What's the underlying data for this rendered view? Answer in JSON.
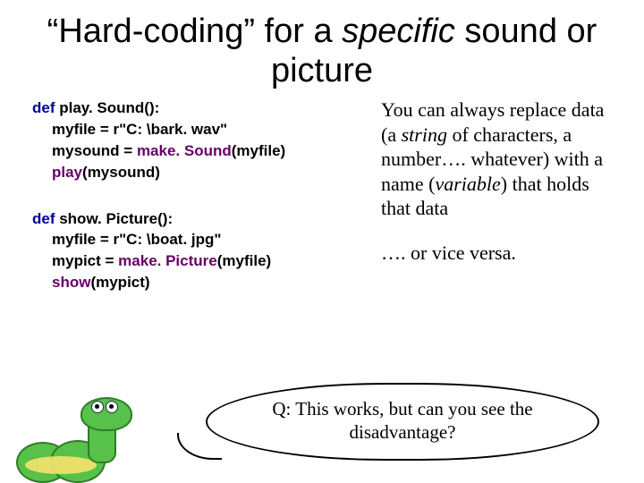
{
  "title": {
    "part1": "“Hard-coding” for a ",
    "italic": "specific",
    "part2": " sound or picture"
  },
  "code": {
    "fn1": {
      "def": "def",
      "name": " play. Sound():",
      "l1a": "myfile = r\"C: \\bark. wav\"",
      "l2a": "mysound = ",
      "l2call": "make. Sound",
      "l2b": "(myfile)",
      "l3call": "play",
      "l3b": "(mysound)"
    },
    "fn2": {
      "def": "def",
      "name": " show. Picture():",
      "l1a": "myfile = r\"C: \\boat. jpg\"",
      "l2a": "mypict = ",
      "l2call": "make. Picture",
      "l2b": "(myfile)",
      "l3call": "show",
      "l3b": "(mypict)"
    }
  },
  "right": {
    "p1a": "You can always replace data (a ",
    "p1i1": "string",
    "p1b": " of characters, a number…. whatever) with a name (",
    "p1i2": "variable",
    "p1c": ") that holds that data",
    "p2": "…. or vice versa."
  },
  "bubble": {
    "text": "Q:  This works, but can you see the disadvantage?"
  }
}
